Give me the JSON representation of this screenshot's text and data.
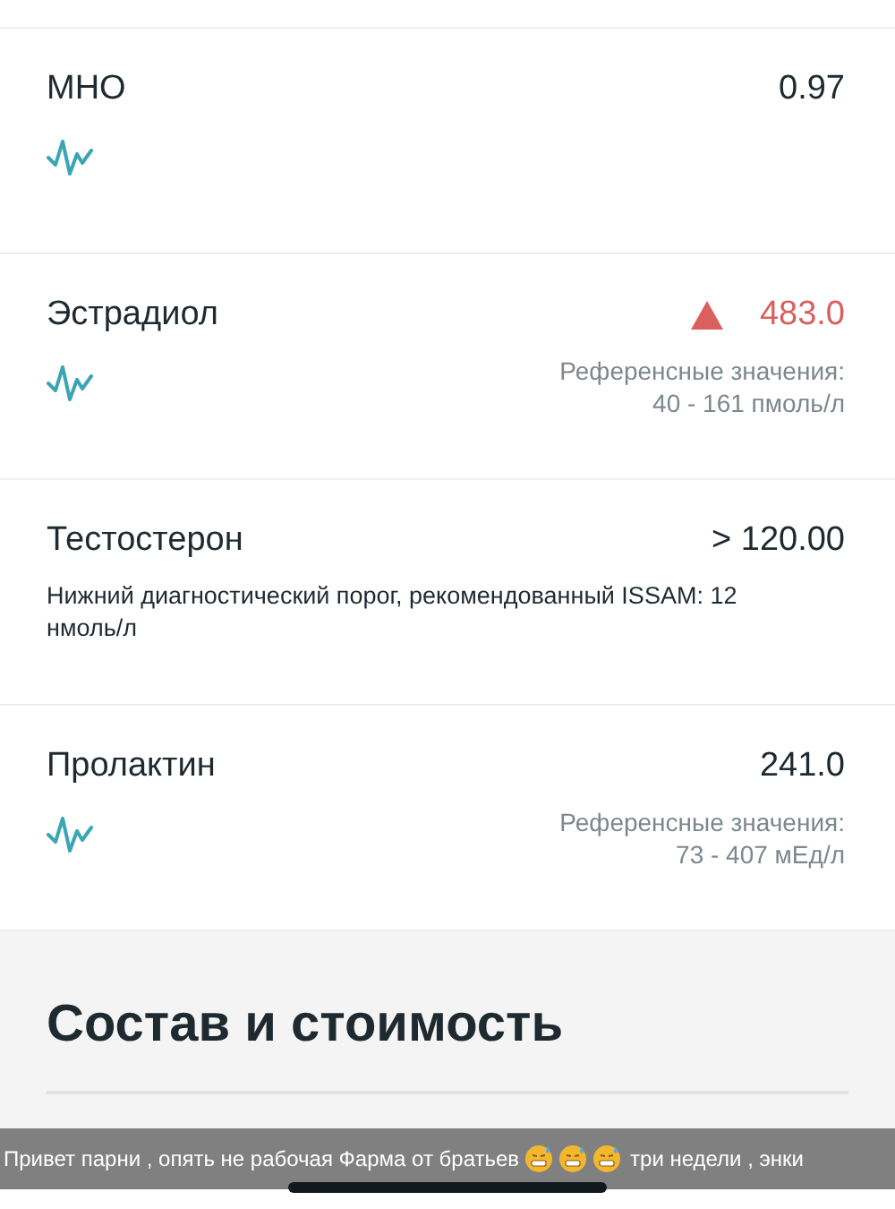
{
  "results": [
    {
      "name": "МНО",
      "value": "0.97",
      "high": false,
      "trend": true
    },
    {
      "name": "Эстрадиол",
      "value": "483.0",
      "high": true,
      "trend": true,
      "reference": [
        "Референсные значения:",
        "40 - 161 пмоль/л"
      ]
    },
    {
      "name": "Тестостерон",
      "value": "> 120.00",
      "high": false,
      "trend": false,
      "note": "Нижний диагностический порог, рекомендованный ISSAM: 12 нмоль/л"
    },
    {
      "name": "Пролактин",
      "value": "241.0",
      "high": false,
      "trend": true,
      "reference": [
        "Референсные значения:",
        "73 - 407 мЕд/л"
      ]
    }
  ],
  "section": {
    "title": "Состав и стоимость"
  },
  "caption": {
    "before": "Привет парни , опять не рабочая Фарма от братьев",
    "emojis": [
      {
        "kind": "sweat_grimace"
      },
      {
        "kind": "sweat_grimace"
      },
      {
        "kind": "sweat_grimace"
      }
    ],
    "after": "три недели , энки"
  }
}
